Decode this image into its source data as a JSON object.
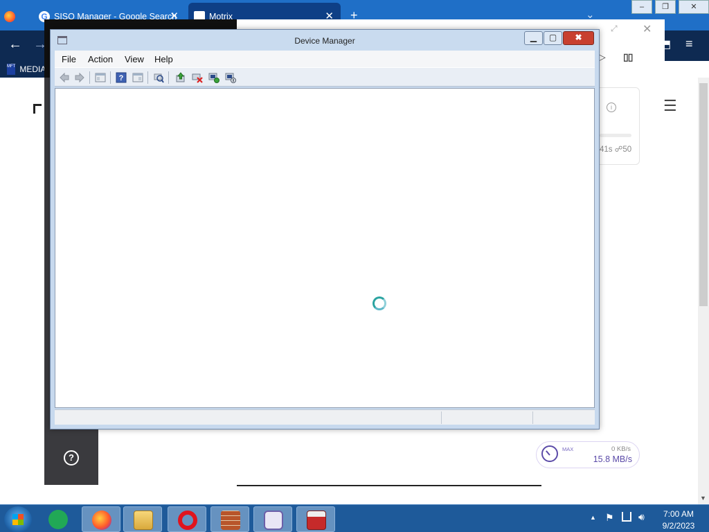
{
  "browser": {
    "tabs": [
      {
        "title": "SISO Manager - Google Search"
      },
      {
        "title": "Motrix"
      }
    ],
    "bookmark_label": "MEDIA",
    "bookmark_icon_text": "MFT"
  },
  "motrix": {
    "task_meta": "41s ☍50",
    "speed": {
      "max_label": "MAX",
      "upload": "0 KB/s",
      "download": "15.8 MB/s"
    },
    "help_glyph": "?"
  },
  "device_manager": {
    "title": "Device Manager",
    "menus": [
      "File",
      "Action",
      "View",
      "Help"
    ],
    "close_glyph": "✖",
    "toolbar_icons": [
      "back-icon",
      "forward-icon",
      "show-hide-console-tree-icon",
      "help-icon",
      "action-pane-icon",
      "scan-hardware-icon",
      "update-driver-icon",
      "uninstall-device-icon",
      "enable-device-icon",
      "disable-device-icon"
    ]
  },
  "taskbar": {
    "time": "7:00 AM",
    "date": "9/2/2023",
    "apps": [
      "firefox",
      "file-explorer",
      "opera",
      "firewall",
      "notes",
      "toolbox"
    ]
  },
  "colors": {
    "taskbar_bg": "#1e5a9a",
    "tabstrip_bg": "#1f6fc7",
    "motrix_accent": "#5b4aa8",
    "dm_close": "#c8402f"
  }
}
